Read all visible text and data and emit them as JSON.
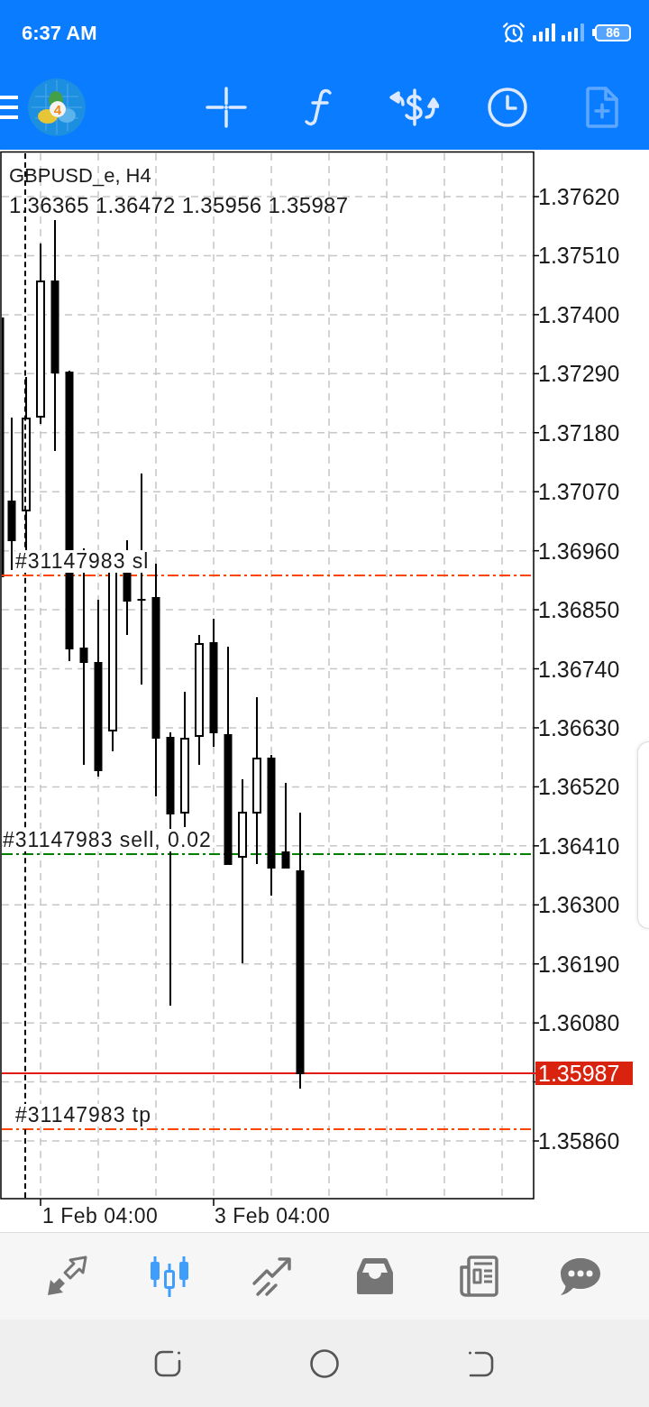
{
  "status_bar": {
    "time": "6:37 AM",
    "battery": "86"
  },
  "toolbar": {
    "logo_badge": "4",
    "tools": [
      {
        "kind": "crosshair",
        "disabled": false
      },
      {
        "kind": "function",
        "disabled": false
      },
      {
        "kind": "currency",
        "disabled": false
      },
      {
        "kind": "clock",
        "disabled": false
      },
      {
        "kind": "document",
        "disabled": true
      }
    ]
  },
  "chart": {
    "symbol": "GBPUSD_e, H4",
    "ohlc": "1.36365 1.36472 1.35956 1.35987",
    "price_axis": [
      {
        "kind": "tick",
        "label": "1.37620"
      },
      {
        "kind": "tick",
        "label": "1.37510"
      },
      {
        "kind": "tick",
        "label": "1.37400"
      },
      {
        "kind": "tick",
        "label": "1.37290"
      },
      {
        "kind": "tick",
        "label": "1.37180"
      },
      {
        "kind": "tick",
        "label": "1.37070"
      },
      {
        "kind": "tick",
        "label": "1.36960"
      },
      {
        "kind": "tick",
        "label": "1.36850"
      },
      {
        "kind": "tick",
        "label": "1.36740"
      },
      {
        "kind": "tick",
        "label": "1.36630"
      },
      {
        "kind": "tick",
        "label": "1.36520"
      },
      {
        "kind": "tick",
        "label": "1.36410"
      },
      {
        "kind": "tick",
        "label": "1.36300"
      },
      {
        "kind": "tick",
        "label": "1.36190"
      },
      {
        "kind": "tick",
        "label": "1.36080"
      },
      {
        "kind": "current",
        "label": "1.35987"
      },
      {
        "kind": "tick",
        "label": "1.35860"
      }
    ],
    "time_axis": [
      "1 Feb 04:00",
      "3 Feb 04:00"
    ],
    "order_lines": [
      {
        "kind": "sl",
        "label": "#31147983 sl",
        "color": "#ff4500"
      },
      {
        "kind": "entry",
        "label": "#31147983 sell, 0.02",
        "color": "#008000"
      },
      {
        "kind": "tp",
        "label": "#31147983 tp",
        "color": "#ff4500"
      }
    ]
  },
  "bottom_nav": [
    {
      "kind": "quotes",
      "selected": false
    },
    {
      "kind": "chart",
      "selected": true
    },
    {
      "kind": "trade",
      "selected": false
    },
    {
      "kind": "history",
      "selected": false
    },
    {
      "kind": "news",
      "selected": false
    },
    {
      "kind": "chat",
      "selected": false
    }
  ],
  "system_nav": [
    {
      "kind": "recent"
    },
    {
      "kind": "home"
    },
    {
      "kind": "back"
    }
  ]
}
